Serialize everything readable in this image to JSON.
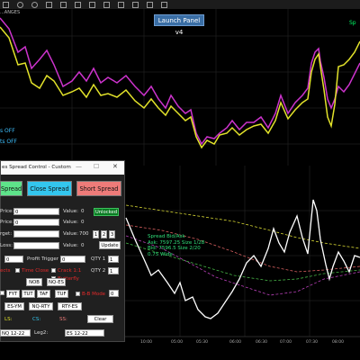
{
  "toolbar": {
    "icons": [
      "pointer-icon",
      "crosshair-icon",
      "zoom-icon",
      "draw-icon",
      "pan-icon",
      "text-icon",
      "lock-icon",
      "grid-icon",
      "list-icon",
      "data-box-icon",
      "snapshot-icon",
      "properties-icon"
    ]
  },
  "top_chart": {
    "instrument_label": "...ANGES",
    "launch_button": "Launch Panel v4",
    "right_label": "Sp",
    "off_labels": [
      "s OFF",
      "ts OFF"
    ],
    "colors": {
      "series_a": "#cc33cc",
      "series_b": "#e2e22a",
      "grid": "#333333"
    }
  },
  "bottom_chart": {
    "time_ticks": [
      "10:00",
      "05:00",
      "05:30",
      "06:00",
      "06:30",
      "07:00",
      "07:30",
      "08:00",
      "08:30",
      "09:00"
    ],
    "tooltip": [
      "Spread Bid/Ask",
      "Ask: 7597.25  Size 1/28",
      "Bid: 7596.5  Size 2/20",
      "0.75 Wide"
    ],
    "colors": {
      "main": "#ffffff",
      "ma1": "#d6d633",
      "ma2": "#d86060",
      "ma3": "#b840b8",
      "ma4": "#48b848"
    }
  },
  "dialog": {
    "title": "es Spread Control - Custom",
    "window_buttons": [
      "—",
      "☐",
      "✕"
    ],
    "buttons": {
      "open": "Spread",
      "close": "Close Spread",
      "short": "Short Spread"
    },
    "rows": [
      {
        "label": "Price:",
        "value": "0",
        "right_label": "Value:",
        "right_value": "0"
      },
      {
        "label": "Price:",
        "value": "0",
        "right_label": "Value:",
        "right_value": "0"
      },
      {
        "label": "rget:",
        "value": "",
        "right_label": "Value:",
        "right_value": "700"
      },
      {
        "label": "Loss:",
        "value": "",
        "right_label": "Value:",
        "right_value": "0"
      }
    ],
    "unlocked": "Unlocked",
    "step_buttons": [
      "1",
      "2",
      "3"
    ],
    "update": "Update",
    "profit_row": {
      "value": "0",
      "profit_label": "Profit Trigger",
      "profit_value": "0",
      "qty1_label": "QTY 1",
      "qty1_value": "1"
    },
    "qty2_label": "QTY 2",
    "qty2_value": "1",
    "checks": {
      "a": "ects",
      "b": "Time Close",
      "c": "Crack 1:1",
      "d": "Butterfly"
    },
    "row_a": [
      "NOB",
      "NQ-ES"
    ],
    "row_b": [
      "FYT",
      "TUT",
      "TAF",
      "TUF"
    ],
    "bb_mode_label": "B-B Mode",
    "bb_mode_value": "0",
    "row_c": [
      "ES-YM",
      "NQ-RTY",
      "RTY-ES"
    ],
    "status": {
      "ls": "LS:",
      "cs": "CS:",
      "ss": "SS:"
    },
    "clear": "Clear",
    "leg1": "NQ 12-22",
    "leg2_label": "Leg2:",
    "leg2": "ES 12-22",
    "colors": {
      "open": "#5ee38a",
      "close": "#33c6ee",
      "short": "#ee7b79"
    }
  }
}
